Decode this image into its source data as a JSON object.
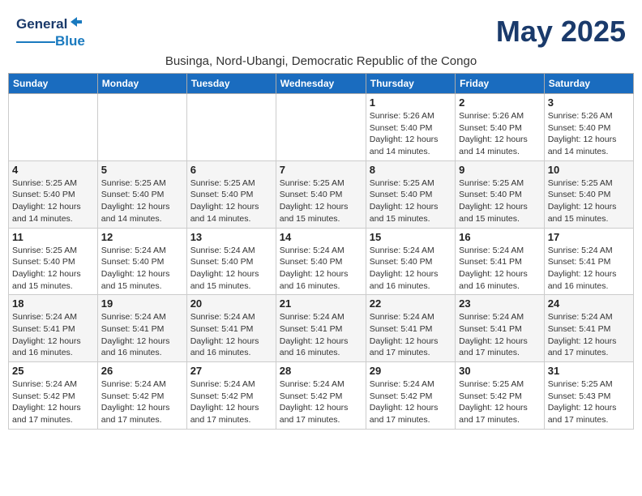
{
  "header": {
    "logo_general": "General",
    "logo_blue": "Blue",
    "month_title": "May 2025",
    "subtitle": "Businga, Nord-Ubangi, Democratic Republic of the Congo"
  },
  "weekdays": [
    "Sunday",
    "Monday",
    "Tuesday",
    "Wednesday",
    "Thursday",
    "Friday",
    "Saturday"
  ],
  "weeks": [
    [
      {
        "day": "",
        "info": ""
      },
      {
        "day": "",
        "info": ""
      },
      {
        "day": "",
        "info": ""
      },
      {
        "day": "",
        "info": ""
      },
      {
        "day": "1",
        "info": "Sunrise: 5:26 AM\nSunset: 5:40 PM\nDaylight: 12 hours\nand 14 minutes."
      },
      {
        "day": "2",
        "info": "Sunrise: 5:26 AM\nSunset: 5:40 PM\nDaylight: 12 hours\nand 14 minutes."
      },
      {
        "day": "3",
        "info": "Sunrise: 5:26 AM\nSunset: 5:40 PM\nDaylight: 12 hours\nand 14 minutes."
      }
    ],
    [
      {
        "day": "4",
        "info": "Sunrise: 5:25 AM\nSunset: 5:40 PM\nDaylight: 12 hours\nand 14 minutes."
      },
      {
        "day": "5",
        "info": "Sunrise: 5:25 AM\nSunset: 5:40 PM\nDaylight: 12 hours\nand 14 minutes."
      },
      {
        "day": "6",
        "info": "Sunrise: 5:25 AM\nSunset: 5:40 PM\nDaylight: 12 hours\nand 14 minutes."
      },
      {
        "day": "7",
        "info": "Sunrise: 5:25 AM\nSunset: 5:40 PM\nDaylight: 12 hours\nand 15 minutes."
      },
      {
        "day": "8",
        "info": "Sunrise: 5:25 AM\nSunset: 5:40 PM\nDaylight: 12 hours\nand 15 minutes."
      },
      {
        "day": "9",
        "info": "Sunrise: 5:25 AM\nSunset: 5:40 PM\nDaylight: 12 hours\nand 15 minutes."
      },
      {
        "day": "10",
        "info": "Sunrise: 5:25 AM\nSunset: 5:40 PM\nDaylight: 12 hours\nand 15 minutes."
      }
    ],
    [
      {
        "day": "11",
        "info": "Sunrise: 5:25 AM\nSunset: 5:40 PM\nDaylight: 12 hours\nand 15 minutes."
      },
      {
        "day": "12",
        "info": "Sunrise: 5:24 AM\nSunset: 5:40 PM\nDaylight: 12 hours\nand 15 minutes."
      },
      {
        "day": "13",
        "info": "Sunrise: 5:24 AM\nSunset: 5:40 PM\nDaylight: 12 hours\nand 15 minutes."
      },
      {
        "day": "14",
        "info": "Sunrise: 5:24 AM\nSunset: 5:40 PM\nDaylight: 12 hours\nand 16 minutes."
      },
      {
        "day": "15",
        "info": "Sunrise: 5:24 AM\nSunset: 5:40 PM\nDaylight: 12 hours\nand 16 minutes."
      },
      {
        "day": "16",
        "info": "Sunrise: 5:24 AM\nSunset: 5:41 PM\nDaylight: 12 hours\nand 16 minutes."
      },
      {
        "day": "17",
        "info": "Sunrise: 5:24 AM\nSunset: 5:41 PM\nDaylight: 12 hours\nand 16 minutes."
      }
    ],
    [
      {
        "day": "18",
        "info": "Sunrise: 5:24 AM\nSunset: 5:41 PM\nDaylight: 12 hours\nand 16 minutes."
      },
      {
        "day": "19",
        "info": "Sunrise: 5:24 AM\nSunset: 5:41 PM\nDaylight: 12 hours\nand 16 minutes."
      },
      {
        "day": "20",
        "info": "Sunrise: 5:24 AM\nSunset: 5:41 PM\nDaylight: 12 hours\nand 16 minutes."
      },
      {
        "day": "21",
        "info": "Sunrise: 5:24 AM\nSunset: 5:41 PM\nDaylight: 12 hours\nand 16 minutes."
      },
      {
        "day": "22",
        "info": "Sunrise: 5:24 AM\nSunset: 5:41 PM\nDaylight: 12 hours\nand 17 minutes."
      },
      {
        "day": "23",
        "info": "Sunrise: 5:24 AM\nSunset: 5:41 PM\nDaylight: 12 hours\nand 17 minutes."
      },
      {
        "day": "24",
        "info": "Sunrise: 5:24 AM\nSunset: 5:41 PM\nDaylight: 12 hours\nand 17 minutes."
      }
    ],
    [
      {
        "day": "25",
        "info": "Sunrise: 5:24 AM\nSunset: 5:42 PM\nDaylight: 12 hours\nand 17 minutes."
      },
      {
        "day": "26",
        "info": "Sunrise: 5:24 AM\nSunset: 5:42 PM\nDaylight: 12 hours\nand 17 minutes."
      },
      {
        "day": "27",
        "info": "Sunrise: 5:24 AM\nSunset: 5:42 PM\nDaylight: 12 hours\nand 17 minutes."
      },
      {
        "day": "28",
        "info": "Sunrise: 5:24 AM\nSunset: 5:42 PM\nDaylight: 12 hours\nand 17 minutes."
      },
      {
        "day": "29",
        "info": "Sunrise: 5:24 AM\nSunset: 5:42 PM\nDaylight: 12 hours\nand 17 minutes."
      },
      {
        "day": "30",
        "info": "Sunrise: 5:25 AM\nSunset: 5:42 PM\nDaylight: 12 hours\nand 17 minutes."
      },
      {
        "day": "31",
        "info": "Sunrise: 5:25 AM\nSunset: 5:43 PM\nDaylight: 12 hours\nand 17 minutes."
      }
    ]
  ]
}
